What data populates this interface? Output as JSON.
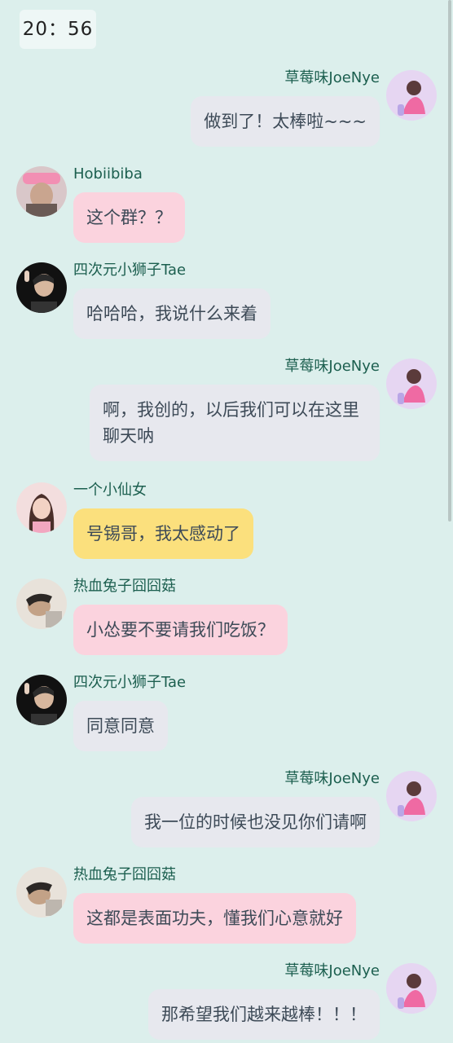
{
  "time": "20：56",
  "messages": [
    {
      "sender": "草莓味JoeNye",
      "text": "做到了！太棒啦~~~"
    },
    {
      "sender": "Hobiibiba",
      "text": "这个群？？"
    },
    {
      "sender": "四次元小狮子Tae",
      "text": "哈哈哈，我说什么来着"
    },
    {
      "sender": "草莓味JoeNye",
      "text": "啊，我创的，以后我们可以在这里聊天呐"
    },
    {
      "sender": "一个小仙女",
      "text": "号锡哥，我太感动了"
    },
    {
      "sender": "热血兔子囧囧菇",
      "text": "小怂要不要请我们吃饭？"
    },
    {
      "sender": "四次元小狮子Tae",
      "text": "同意同意"
    },
    {
      "sender": "草莓味JoeNye",
      "text": "我一位的时候也没见你们请啊"
    },
    {
      "sender": "热血兔子囧囧菇",
      "text": "这都是表面功夫，懂我们心意就好"
    },
    {
      "sender": "草莓味JoeNye",
      "text": "那希望我们越来越棒！！！"
    }
  ],
  "colors": {
    "background": "#dcefec",
    "sender_name": "#1c5f4f",
    "bubble_gray": "#e7e8ee",
    "bubble_pink": "#fbd3de",
    "bubble_yellow": "#fbe07d"
  }
}
